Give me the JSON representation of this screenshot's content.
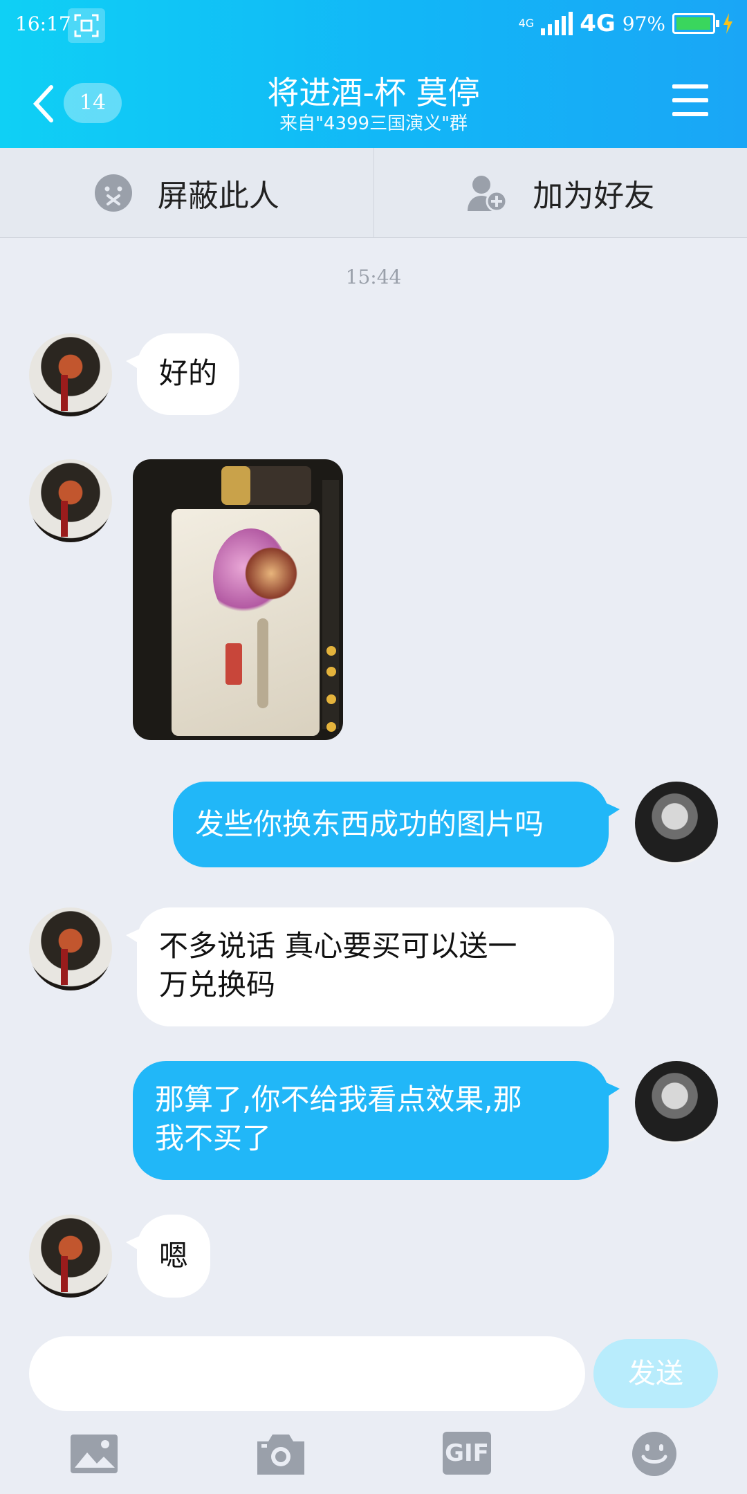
{
  "status_bar": {
    "time": "16:17",
    "network_small": "4G",
    "network": "4G",
    "battery_pct": "97%",
    "battery_level": 0.97
  },
  "header": {
    "unread_count": "14",
    "title": "将进酒-杯 莫停",
    "subtitle": "来自\"4399三国演义\"群",
    "icons": [
      "back-chevron-icon",
      "menu-icon"
    ]
  },
  "actions": {
    "block_label": "屏蔽此人",
    "add_friend_label": "加为好友"
  },
  "chat": {
    "timestamp": "15:44",
    "messages": [
      {
        "from": "other",
        "type": "text",
        "text": "好的"
      },
      {
        "from": "other",
        "type": "image"
      },
      {
        "from": "me",
        "type": "text",
        "text": "发些你换东西成功的图片吗"
      },
      {
        "from": "other",
        "type": "text",
        "lines": [
          "不多说话 真心要买可以送一",
          "万兑换码"
        ]
      },
      {
        "from": "me",
        "type": "text",
        "lines": [
          "那算了,你不给我看点效果,那",
          "我不买了"
        ]
      },
      {
        "from": "other",
        "type": "text",
        "text": "嗯"
      }
    ]
  },
  "compose": {
    "input_value": "",
    "send_label": "发送",
    "gif_label": "GIF",
    "tools": [
      "image-icon",
      "camera-icon",
      "gif-icon",
      "emoji-icon"
    ]
  },
  "colors": {
    "header_start": "#0fd0f5",
    "header_end": "#1aa6f6",
    "outgoing_bubble": "#21b7f8",
    "background": "#eaedf4",
    "send_disabled": "#b8ecfc"
  }
}
